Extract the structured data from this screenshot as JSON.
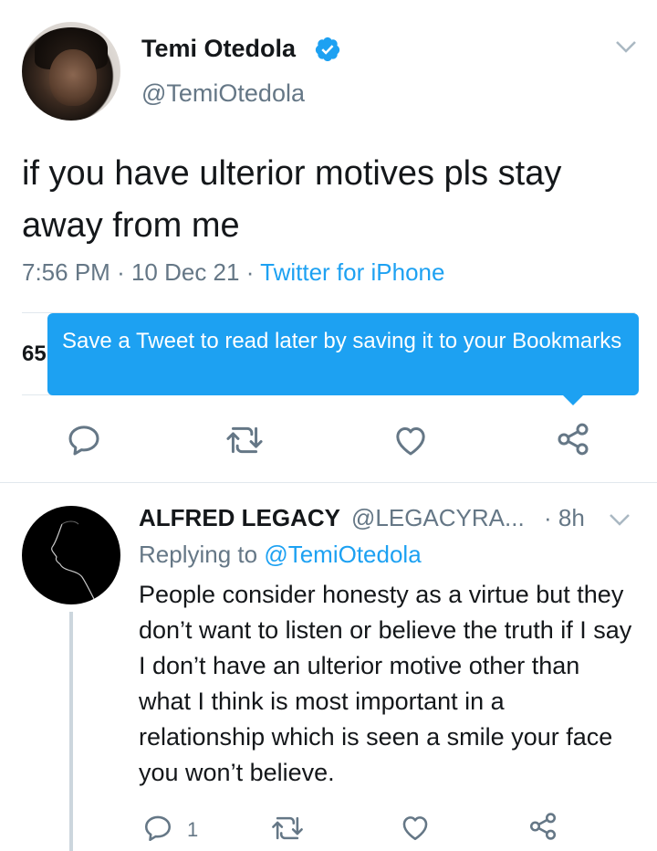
{
  "tweet": {
    "author_name": "Temi Otedola",
    "author_handle": "@TemiOtedola",
    "text": "if you have ulterior motives pls stay away from me",
    "time": "7:56 PM",
    "date": "10 Dec 21",
    "source": "Twitter for iPhone",
    "stats_partial": "65"
  },
  "tooltip": {
    "text": "Save a Tweet to read later by saving it to your Bookmarks"
  },
  "reply": {
    "author_name": "ALFRED LEGACY",
    "author_handle": "@LEGACYRA...",
    "time": "8h",
    "replying_label": "Replying to",
    "replying_to": "@TemiOtedola",
    "text": "People consider honesty as a virtue but they don’t want to listen or believe the truth if I say I don’t have an ulterior motive other than what I think is most important in a relationship which is seen a smile your face you won’t believe.",
    "reply_count": "1"
  },
  "colors": {
    "accent": "#1da1f2",
    "secondary_text": "#657786",
    "primary_text": "#14171a",
    "divider": "#e1e8ed"
  },
  "icons": [
    "verified-icon",
    "chevron-down-icon",
    "reply-icon",
    "retweet-icon",
    "like-icon",
    "share-icon"
  ]
}
